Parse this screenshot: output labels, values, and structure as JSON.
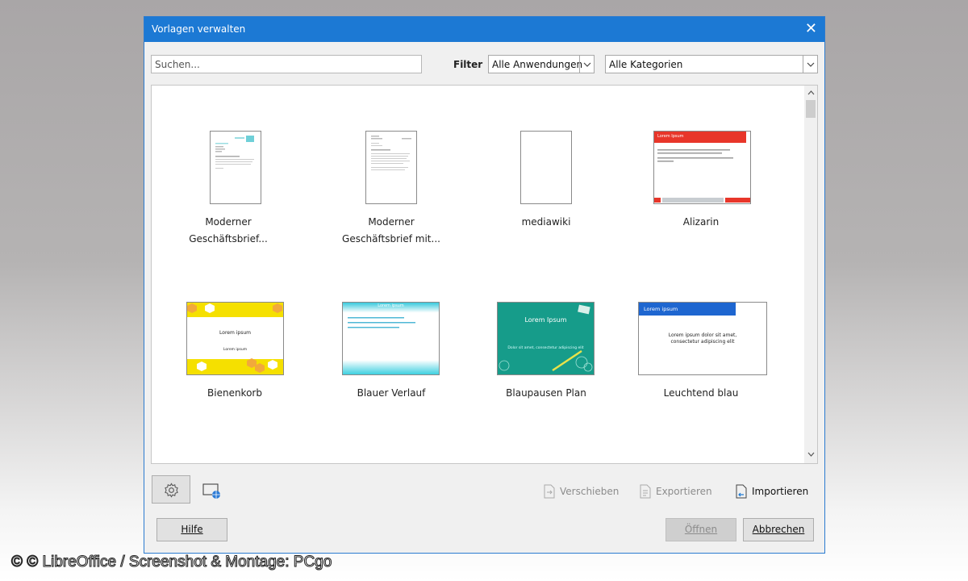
{
  "window": {
    "title": "Vorlagen verwalten",
    "close_glyph": "✕"
  },
  "toolbar": {
    "search_placeholder": "Suchen...",
    "filter_label": "Filter",
    "application_filter": "Alle Anwendungen",
    "category_filter": "Alle Kategorien"
  },
  "templates": [
    {
      "label_line1": "Moderner",
      "label_line2": "Geschäftsbrief..."
    },
    {
      "label_line1": "Moderner",
      "label_line2": "Geschäftsbrief mit..."
    },
    {
      "label_line1": "mediawiki",
      "label_line2": ""
    },
    {
      "label_line1": "Alizarin",
      "label_line2": "",
      "thumb_title": "Lorem Ipsum",
      "accent": "#e8362a"
    },
    {
      "label_line1": "Bienenkorb",
      "label_line2": "",
      "thumb_title": "Lorem ipsum",
      "thumb_sub": "Lorem ipsum",
      "accent": "#f5e000"
    },
    {
      "label_line1": "Blauer Verlauf",
      "label_line2": "",
      "thumb_title": "Lorem ipsum",
      "accent": "#2ec4d6"
    },
    {
      "label_line1": "Blaupausen Plan",
      "label_line2": "",
      "thumb_title": "Lorem Ipsum",
      "thumb_sub": "Dolor sit amet, consectetur adipiscing elit",
      "accent": "#169c8a"
    },
    {
      "label_line1": "Leuchtend blau",
      "label_line2": "",
      "thumb_title": "Lorem ipsum",
      "thumb_body1": "Lorem ipsum dolor sit amet,",
      "thumb_body2": "consectetur adipiscing elit",
      "accent": "#1e66d0"
    }
  ],
  "actions": {
    "move": "Verschieben",
    "export": "Exportieren",
    "import": "Importieren"
  },
  "buttons": {
    "help": "Hilfe",
    "open": "Öffnen",
    "cancel": "Abbrechen"
  },
  "credit": "© © LibreOffice / Screenshot & Montage: PCgo"
}
